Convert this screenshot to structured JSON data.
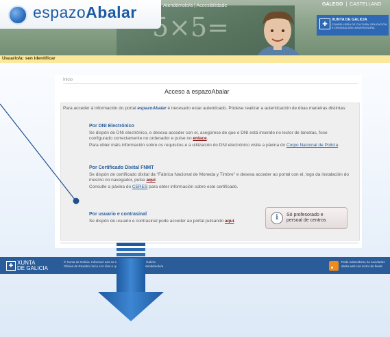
{
  "header": {
    "logo_prefix": "espazo",
    "logo_bold": "Abalar",
    "nav_links": "Atendémolo/a  |  Accesibilidade",
    "chalk_text": "5×5=",
    "lang_galego": "GALEGO",
    "lang_castellano": "CASTELLANO",
    "xunta_title": "XUNTA DE GALICIA",
    "xunta_sub1": "CONSELLERÍA DE CULTURA, EDUCACIÓN",
    "xunta_sub2": "E ORDENACIÓN UNIVERSITARIA"
  },
  "user_bar": {
    "label": "Usuario/a:  sen identificar"
  },
  "main": {
    "breadcrumb": "Inicio",
    "title": "Acceso a espazoAbalar",
    "intro_before": "Para acceder á información do portal ",
    "intro_bold": "espazoAbalar",
    "intro_after": " é necesario estar autenticado. Pódese realizar a autenticación de dúas maneiras distintas:",
    "dni": {
      "heading": "Por DNI Electrónico",
      "p1_before": "Se dispón de DNI electrónico, e desexa acceder con el, asegúrese de que o DNI está inserido no lector de tarxetas, fose configurado correctamente no ordenador e pulse no ",
      "p1_link": "enlace",
      "p1_after": ".",
      "p2_before": "Para obter máis información sobre os requisitos e a utilización do DNI electrónico visite a páxina do ",
      "p2_link": "Corpo Nacional de Policía",
      "p2_after": "."
    },
    "fnmt": {
      "heading": "Por Certificado Dixital FNMT",
      "p1_before": "Se dispón de certificado dixital da \"Fábrica Nacional de Moneda y Timbre\" e desexa acceder ao portal con el, logo da instalación do mesmo no navegador, pulse ",
      "p1_link": "aquí",
      "p1_after": ".",
      "p2_before": "Consulte a páxina do ",
      "p2_link": "CERES",
      "p2_after": " para obter información sobre este certificado."
    },
    "userpass": {
      "heading": "Por usuario e contrasinal",
      "p1_before": "Se dispón de usuario e contrasinal pode acceder ao portal pulsando ",
      "p1_link": "aquí",
      "p1_after": "."
    },
    "prof_button": {
      "line1": "Só profesorado e",
      "line2": "persoal de centros"
    }
  },
  "footer": {
    "xunta_line1": "XUNTA",
    "xunta_line2": "DE GALICIA",
    "line1": "© Xunta de Galicia. Informaci                     ado na internet polo Xunta de Galicia",
    "line2": "Oficina de Rexistro único e In                        ións e queixas  |  Aviso legal  |  Atendémolo/a",
    "rss_line1": "Pode subscribirse ás novidades",
    "rss_line2": "desta web cun lector de feeds"
  },
  "colors": {
    "footer_bg": "#2a5c9a",
    "arrow": "#2f6fb4",
    "annotation_line": "#1f4f8e",
    "user_bar": "#fbe89b"
  }
}
